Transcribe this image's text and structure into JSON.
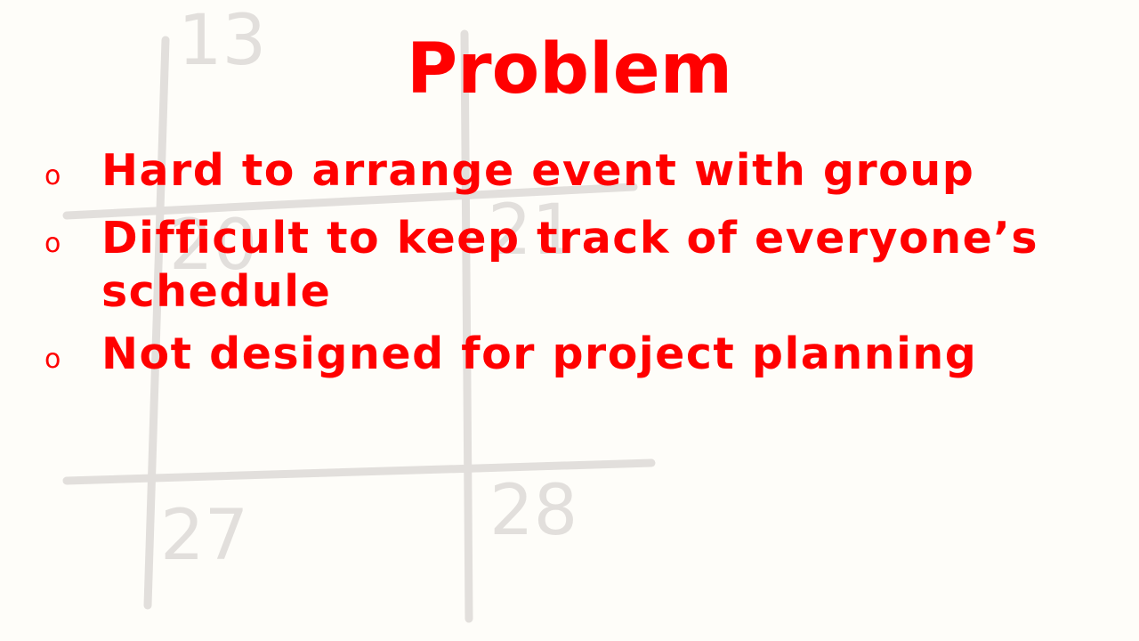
{
  "background": {
    "calendar_numbers": [
      "13",
      "20",
      "21",
      "27",
      "28"
    ]
  },
  "slide": {
    "title": "Problem",
    "bullets": [
      {
        "marker": "o",
        "text": "Hard to arrange event with group"
      },
      {
        "marker": "o",
        "text": "Difficult to keep track of everyone’s schedule"
      },
      {
        "marker": "o",
        "text": "Not designed for project planning"
      }
    ]
  },
  "colors": {
    "title": "#ff0000",
    "text": "#ff0000",
    "background": "#fefdf9",
    "calendar_lines": "#e2dfdc"
  }
}
